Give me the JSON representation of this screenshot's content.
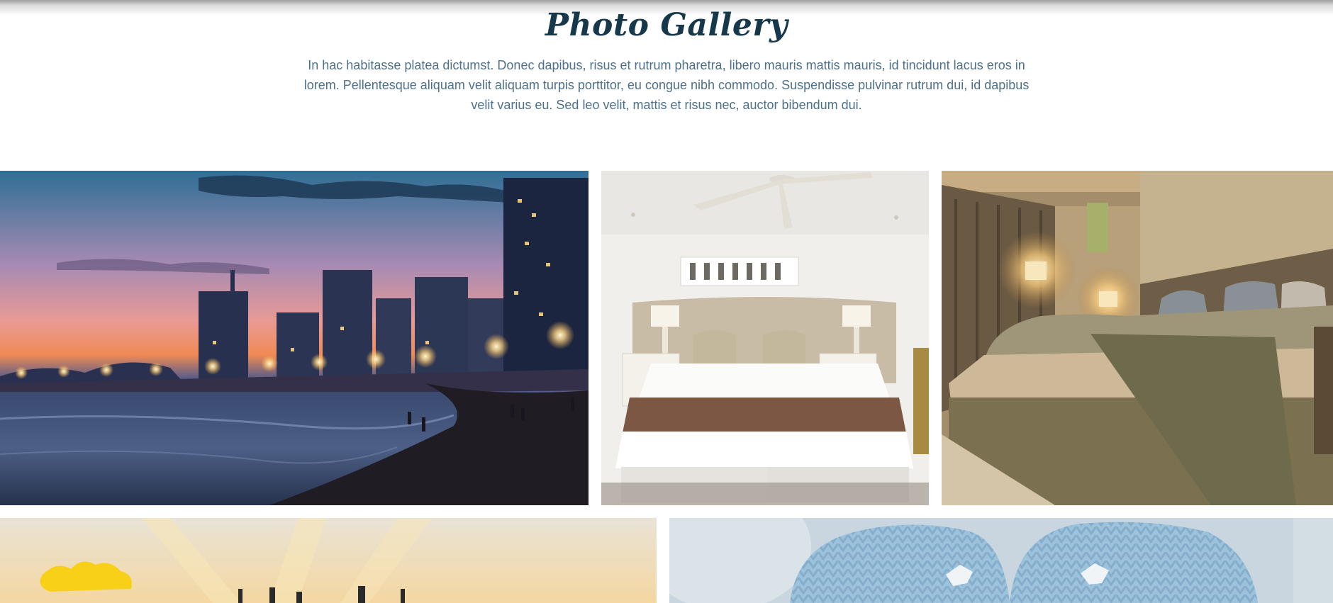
{
  "gallery": {
    "title": "Photo Gallery",
    "description": "In hac habitasse platea dictumst. Donec dapibus, risus et rutrum pharetra, libero mauris mattis mauris, id tincidunt lacus eros in lorem. Pellentesque aliquam velit aliquam turpis porttitor, eu congue nibh commodo. Suspendisse pulvinar rutrum dui, id dapibus velit varius eu. Sed leo velit, mattis et risus nec, auctor bibendum dui."
  },
  "colors": {
    "title": "#16384a",
    "body_text": "#4f7089",
    "background": "#ffffff"
  },
  "photos": [
    {
      "subject": "city-beach-sunset-photo"
    },
    {
      "subject": "hotel-bedroom-white-photo"
    },
    {
      "subject": "hotel-bedroom-warm-photo"
    },
    {
      "subject": "sunrise-skyline-photo"
    },
    {
      "subject": "knitted-mittens-photo"
    }
  ]
}
